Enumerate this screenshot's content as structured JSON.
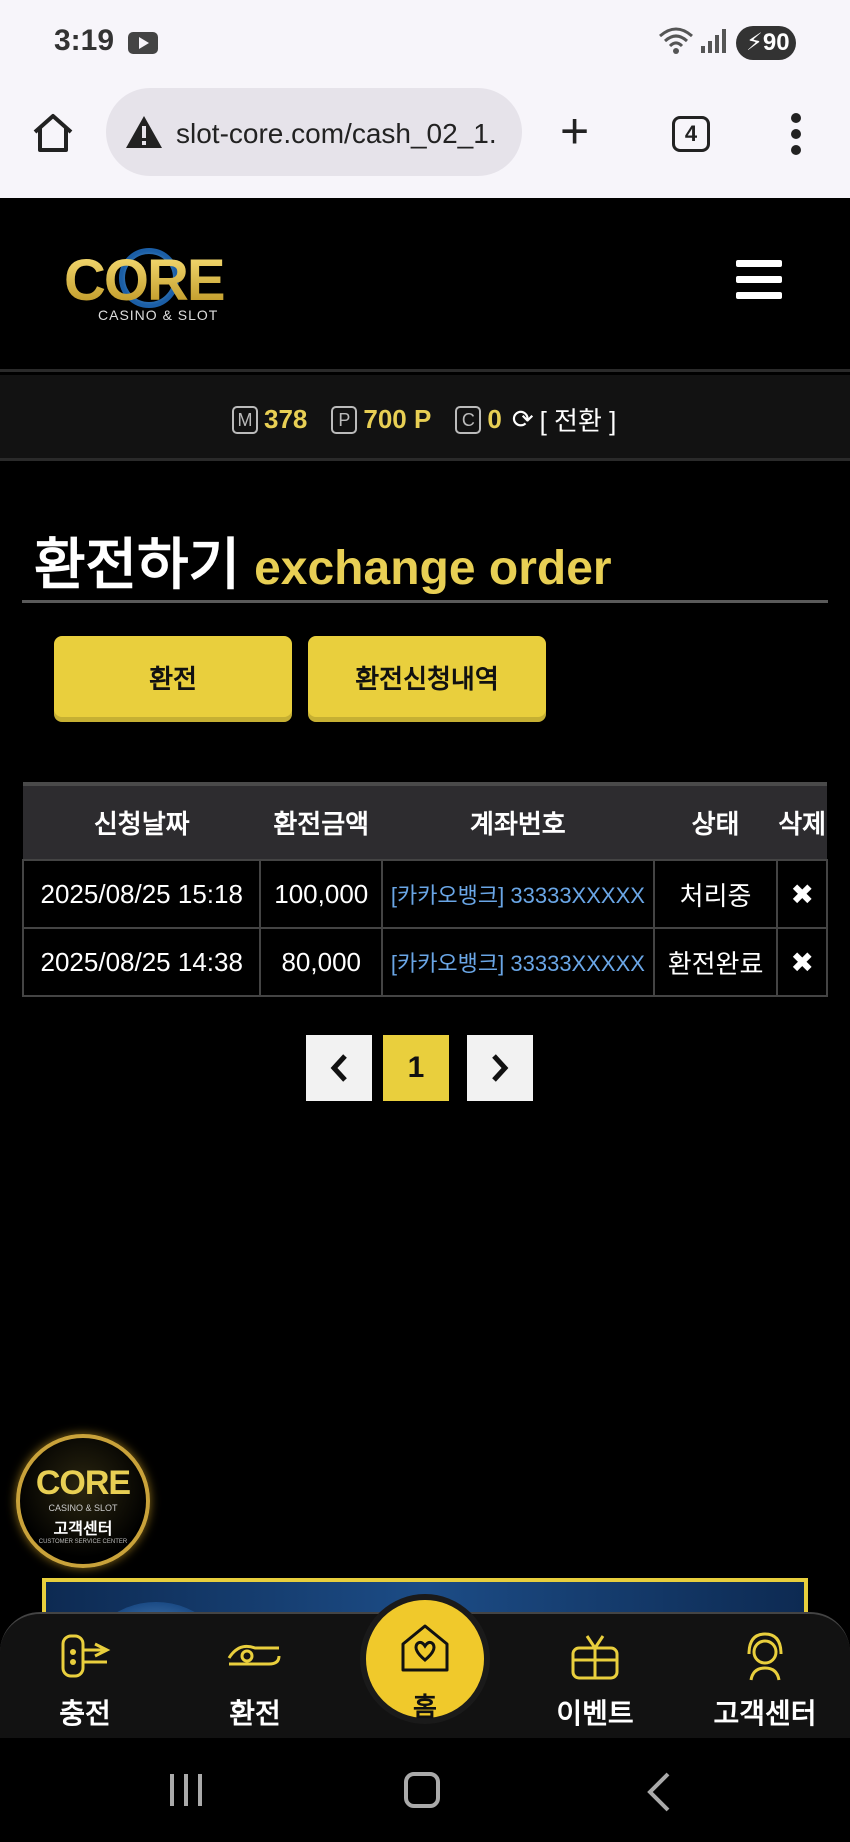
{
  "status_bar": {
    "time": "3:19",
    "battery": "90"
  },
  "browser": {
    "url": "slot-core.com/cash_02_1.",
    "tab_count": "4"
  },
  "site": {
    "logo_text": "CORE",
    "logo_sub": "CASINO & SLOT"
  },
  "balance": {
    "money_badge": "M",
    "money_value": "378",
    "point_badge": "P",
    "point_value": "700 P",
    "coin_badge": "C",
    "coin_value": "0",
    "switch_label": "[ 전환 ]"
  },
  "page": {
    "title_ko": "환전하기",
    "title_en": "exchange order"
  },
  "tabs": {
    "exchange_label": "환전",
    "history_label": "환전신청내역"
  },
  "table": {
    "headers": [
      "신청날짜",
      "환전금액",
      "계좌번호",
      "상태",
      "삭제"
    ],
    "rows": [
      {
        "date": "2025/08/25 15:18",
        "amount": "100,000",
        "account": "[카카오뱅크] 33333XXXXX",
        "status": "처리중",
        "delete": "✖"
      },
      {
        "date": "2025/08/25 14:38",
        "amount": "80,000",
        "account": "[카카오뱅크] 33333XXXXX",
        "status": "환전완료",
        "delete": "✖"
      }
    ]
  },
  "pagination": {
    "current": "1"
  },
  "cs_float": {
    "logo": "CORE",
    "sub": "CASINO & SLOT",
    "label": "고객센터",
    "sub2": "CUSTOMER SERVICE CENTER"
  },
  "bottom_nav": {
    "charge": "충전",
    "exchange": "환전",
    "home": "홈",
    "event": "이벤트",
    "support": "고객센터"
  },
  "colors": {
    "accent": "#e9cf3d",
    "link": "#6aa6e6",
    "background": "#000000"
  }
}
